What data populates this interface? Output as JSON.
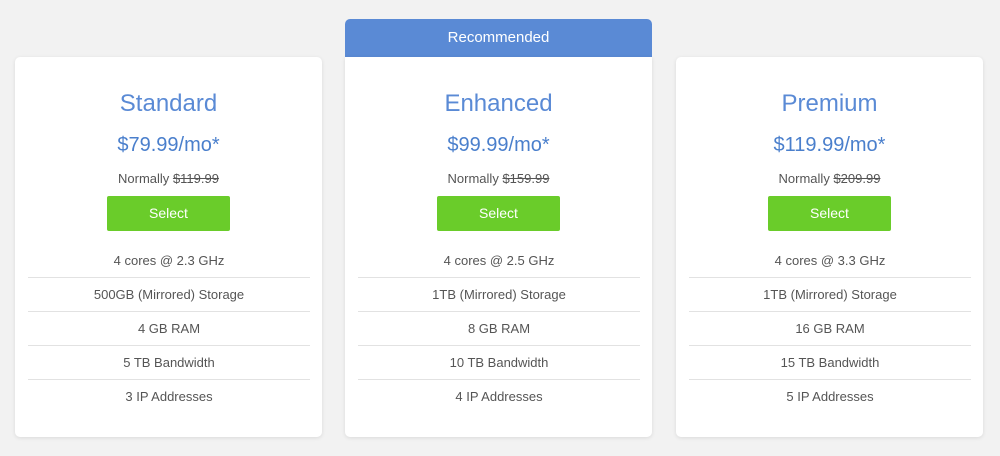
{
  "recommended_label": "Recommended",
  "plans": [
    {
      "name": "Standard",
      "price": "$79.99/mo*",
      "normally_label": "Normally",
      "old_price": "$119.99",
      "select_label": "Select",
      "features": [
        "4 cores @ 2.3 GHz",
        "500GB (Mirrored) Storage",
        "4 GB RAM",
        "5 TB Bandwidth",
        "3 IP Addresses"
      ]
    },
    {
      "name": "Enhanced",
      "price": "$99.99/mo*",
      "normally_label": "Normally",
      "old_price": "$159.99",
      "select_label": "Select",
      "features": [
        "4 cores @ 2.5 GHz",
        "1TB (Mirrored) Storage",
        "8 GB RAM",
        "10 TB Bandwidth",
        "4 IP Addresses"
      ]
    },
    {
      "name": "Premium",
      "price": "$119.99/mo*",
      "normally_label": "Normally",
      "old_price": "$209.99",
      "select_label": "Select",
      "features": [
        "4 cores @ 3.3 GHz",
        "1TB (Mirrored) Storage",
        "16 GB RAM",
        "15 TB Bandwidth",
        "5 IP Addresses"
      ]
    }
  ],
  "colors": {
    "accent_blue": "#5a8ad5",
    "price_blue": "#4a7fcc",
    "button_green": "#6acc2a",
    "background": "#f2f2f2"
  }
}
